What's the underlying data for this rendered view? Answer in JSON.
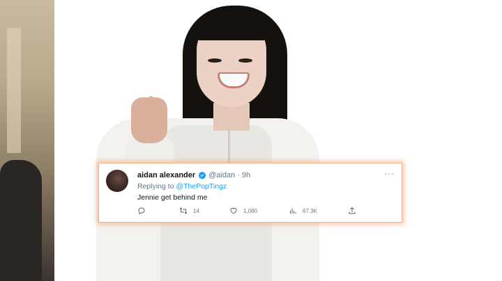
{
  "tweet": {
    "display_name": "aidan alexander",
    "handle": "@aidan",
    "separator": "·",
    "time": "9h",
    "more": "···",
    "reply_prefix": "Replying to",
    "reply_to": "@ThePopTingz",
    "text": "Jennie get behind me",
    "actions": {
      "reply": "",
      "retweets": "14",
      "likes": "1,080",
      "views": "67.3K",
      "share": ""
    }
  },
  "icons": {
    "verified": "verified-badge-icon",
    "reply": "reply-icon",
    "retweet": "retweet-icon",
    "like": "heart-icon",
    "views": "bar-chart-icon",
    "share": "share-icon"
  },
  "colors": {
    "accent": "#1d9bf0",
    "muted": "#657786",
    "glow": "#f4a478"
  }
}
